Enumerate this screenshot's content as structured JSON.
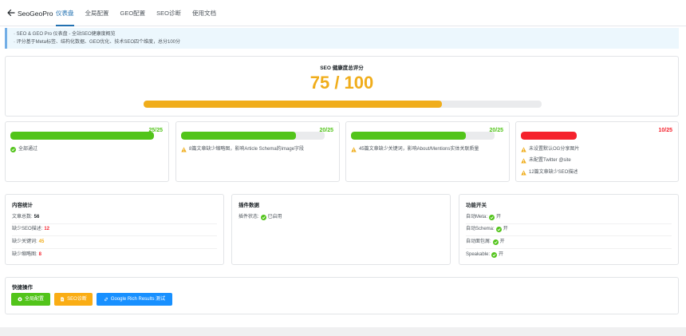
{
  "header": {
    "brand": "SeoGeoPro",
    "tabs": [
      {
        "label": "仪表盘",
        "active": true
      },
      {
        "label": "全局配置"
      },
      {
        "label": "GEO配置"
      },
      {
        "label": "SEO诊断"
      },
      {
        "label": "使用文档"
      }
    ]
  },
  "notice": {
    "line1": "· SEO & GEO Pro 仪表盘 - 全站SEO健康度概览",
    "line2": "· 评分基于Meta标签、结构化数据、GEO优化、技术SEO四个维度，总分100分"
  },
  "score": {
    "title": "SEO 健康度总评分",
    "value_text": "75 / 100",
    "fraction": 0.75,
    "color": "#f0ad1b"
  },
  "categories": [
    {
      "score_text": "25/25",
      "fraction": 1.0,
      "color": "#52c41a",
      "items": [
        {
          "icon": "check-circle-icon",
          "text": "全部通过"
        }
      ]
    },
    {
      "score_text": "20/25",
      "fraction": 0.8,
      "color": "#52c41a",
      "items": [
        {
          "icon": "warning-icon",
          "text": "8篇文章缺少缩略图，影响Article Schema的image字段"
        }
      ]
    },
    {
      "score_text": "20/25",
      "fraction": 0.8,
      "color": "#52c41a",
      "items": [
        {
          "icon": "warning-icon",
          "text": "45篇文章缺少关键词，影响About/Mentions实体关联质量"
        }
      ]
    },
    {
      "score_text": "10/25",
      "fraction": 0.4,
      "color": "#f5222d",
      "items": [
        {
          "icon": "warning-icon",
          "text": "未设置默认OG分享图片"
        },
        {
          "icon": "warning-icon",
          "text": "未配置Twitter @site"
        },
        {
          "icon": "warning-icon",
          "text": "12篇文章缺少SEO描述"
        }
      ]
    }
  ],
  "content_stats": {
    "title": "内容统计",
    "rows": [
      {
        "label": "文章总数:",
        "value": "56",
        "color": "#1d2327"
      },
      {
        "label": "缺少SEO描述:",
        "value": "12",
        "color": "#f5222d"
      },
      {
        "label": "缺少关键词:",
        "value": "45",
        "color": "#f0ad1b"
      },
      {
        "label": "缺少缩略图:",
        "value": "8",
        "color": "#f5222d"
      }
    ]
  },
  "plugin_data": {
    "title": "插件数据",
    "rows": [
      {
        "label": "插件状态:",
        "value": "已启用"
      }
    ]
  },
  "features": {
    "title": "功能开关",
    "rows": [
      {
        "label": "自动Meta:",
        "value": "开"
      },
      {
        "label": "自动Schema:",
        "value": "开"
      },
      {
        "label": "自动面包屑:",
        "value": "开"
      },
      {
        "label": "Speakable:",
        "value": "开"
      }
    ]
  },
  "quick_actions": {
    "title": "快捷操作",
    "buttons": [
      {
        "label": "全局配置",
        "icon": "gear-icon",
        "color": "#52c41a"
      },
      {
        "label": "SEO诊断",
        "icon": "document-icon",
        "color": "#faad14"
      },
      {
        "label": "Google Rich Results 测试",
        "icon": "link-icon",
        "color": "#1890ff"
      }
    ]
  },
  "colors": {
    "accent": "#2271b1",
    "success": "#52c41a",
    "warning": "#f0ad1b",
    "danger": "#f5222d",
    "info": "#1890ff"
  }
}
